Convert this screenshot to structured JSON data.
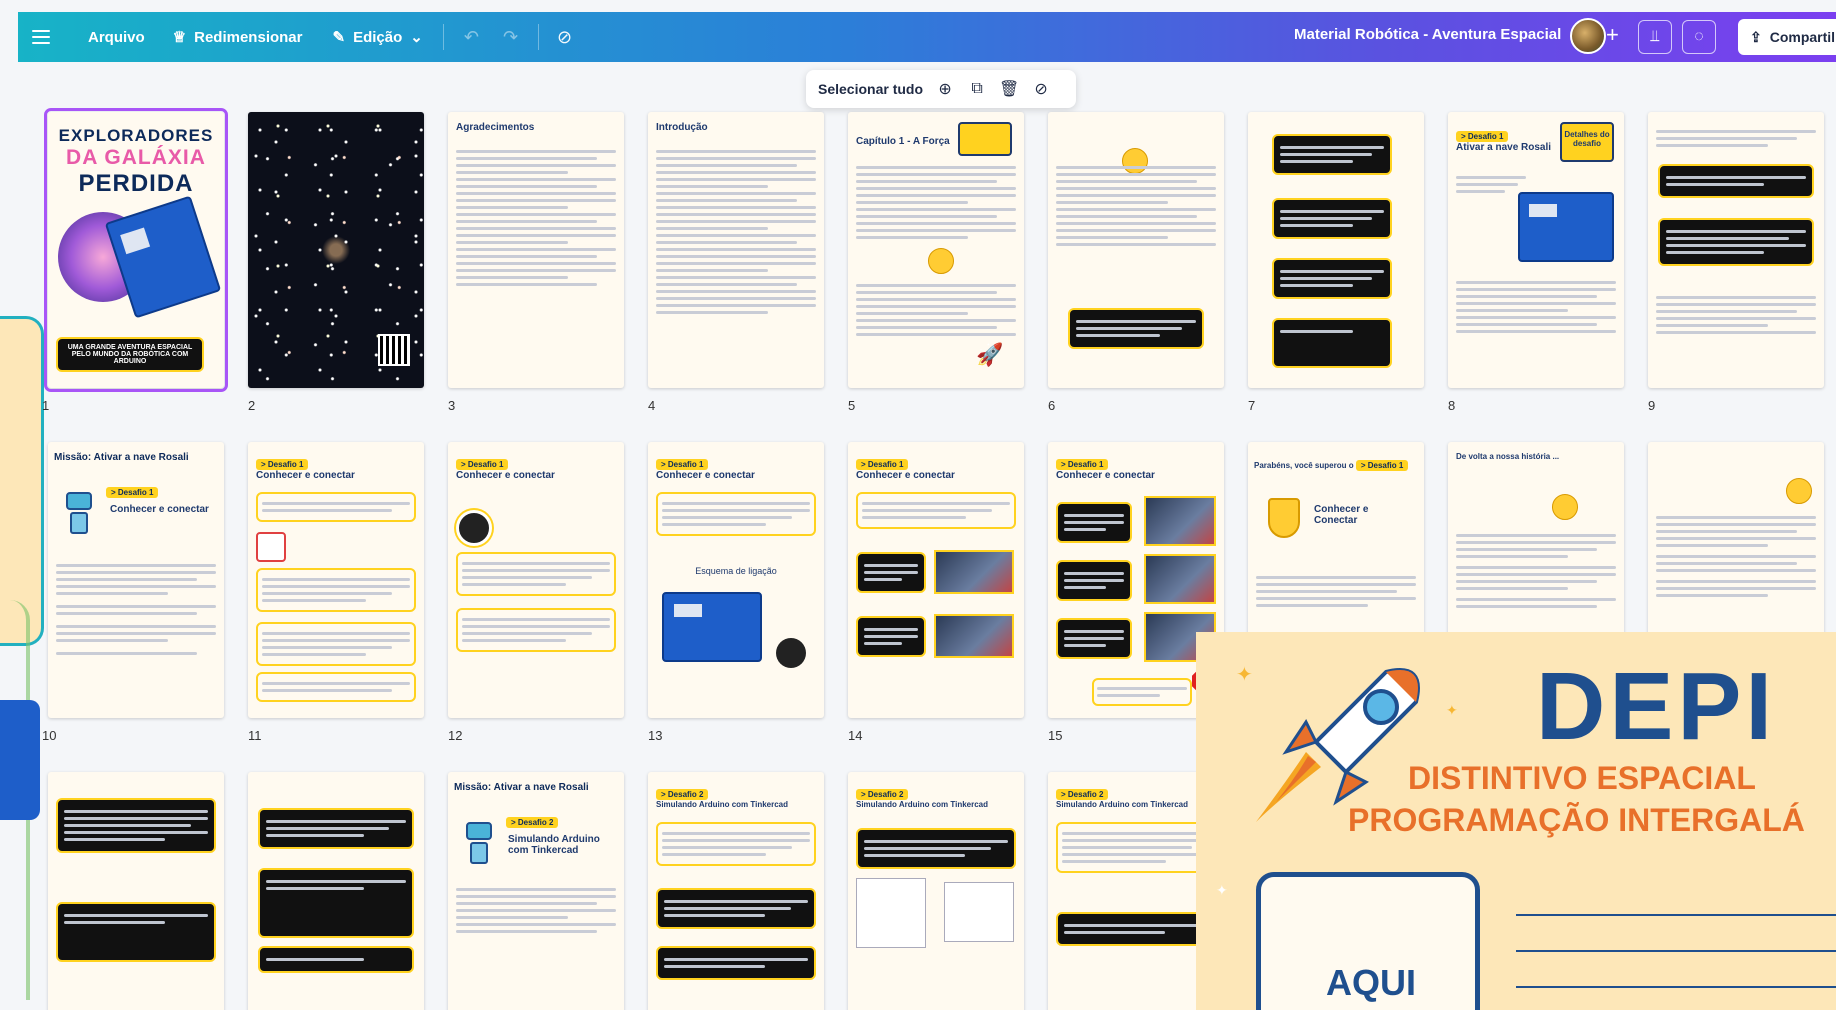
{
  "topbar": {
    "menu_label": "Arquivo",
    "resize_label": "Redimensionar",
    "edit_label": "Edição",
    "doc_title": "Material Robótica - Aventura Espacial",
    "share_label": "Compartilhar"
  },
  "selection_toolbar": {
    "select_all_label": "Selecionar tudo"
  },
  "pages": [
    {
      "num": "1"
    },
    {
      "num": "2"
    },
    {
      "num": "3"
    },
    {
      "num": "4"
    },
    {
      "num": "5"
    },
    {
      "num": "6"
    },
    {
      "num": "7"
    },
    {
      "num": "8"
    },
    {
      "num": "9"
    },
    {
      "num": "10"
    },
    {
      "num": "11"
    },
    {
      "num": "12"
    },
    {
      "num": "13"
    },
    {
      "num": "14"
    },
    {
      "num": "15"
    }
  ],
  "page_content": {
    "cover": {
      "line1": "EXPLORADORES",
      "line2": "DA GALÁXIA",
      "line3": "PERDIDA",
      "foot": "UMA GRANDE AVENTURA ESPACIAL PELO MUNDO DA ROBÓTICA COM ARDUINO"
    },
    "p3_title": "Agradecimentos",
    "p4_title": "Introdução",
    "p5_title": "Capítulo 1 - A Força",
    "p8_badge": "> Desafio 1",
    "p8_title": "Ativar a nave Rosali",
    "p8_tag": "Detalhes do desafio",
    "p10_title": "Missão: Ativar a nave Rosali",
    "p10_badge": "> Desafio 1",
    "p10_sub": "Conhecer e conectar",
    "p11_badge": "> Desafio 1",
    "p11_title": "Conhecer e conectar",
    "p12_badge": "> Desafio 1",
    "p12_title": "Conhecer e conectar",
    "p13_badge": "> Desafio 1",
    "p13_title": "Conhecer e conectar",
    "p13_diagram": "Esquema de ligação",
    "p14_badge": "> Desafio 1",
    "p14_title": "Conhecer e conectar",
    "p15_badge": "> Desafio 1",
    "p15_title": "Conhecer e conectar",
    "p16_title": "Parabéns, você superou o",
    "p16_badge": "> Desafio 1",
    "p16_sub": "Conhecer e Conectar",
    "p17_title": "De volta a nossa história ...",
    "r3_p3_title": "Missão: Ativar a nave Rosali",
    "r3_p3_badge": "> Desafio 2",
    "r3_p3_sub": "Simulando Arduino com Tinkercad",
    "r3_p4_badge": "> Desafio 2",
    "r3_p4_title": "Simulando Arduino com Tinkercad",
    "r3_p5_badge": "> Desafio 2",
    "r3_p5_title": "Simulando Arduino com Tinkercad",
    "r3_p6_badge": "> Desafio 2",
    "r3_p6_title": "Simulando Arduino com Tinkercad"
  },
  "depi": {
    "title": "DEPI",
    "sub1": "DISTINTIVO ESPACIAL",
    "sub2": "PROGRAMAÇÃO INTERGALÁ",
    "box_label": "AQUI"
  },
  "colors": {
    "accent_purple": "#a855f7",
    "badge_yellow": "#ffd21f",
    "navy": "#1f4f8e",
    "orange": "#e8702a"
  }
}
